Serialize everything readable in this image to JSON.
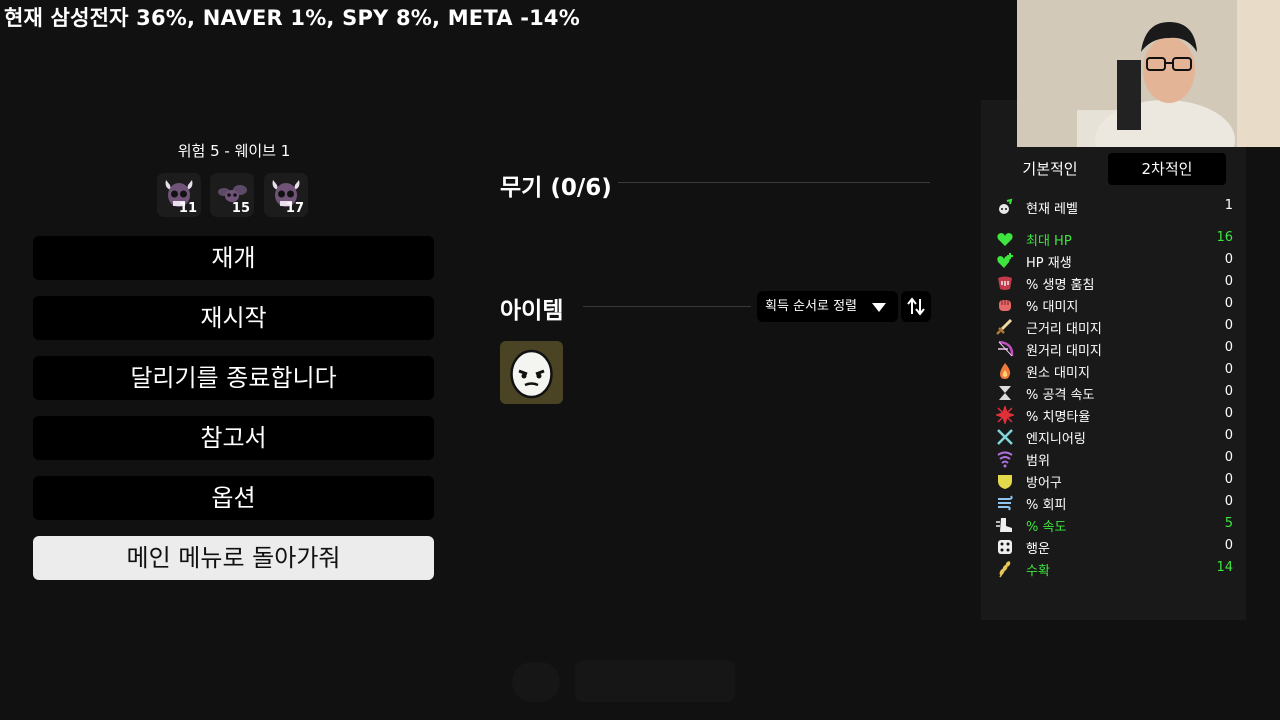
{
  "ticker": "현재 삼성전자 36%, NAVER 1%, SPY 8%, META -14%",
  "danger_wave": "위험 5 - 웨이브 1",
  "enemies": [
    {
      "icon": "horned-skull-icon",
      "count": "11"
    },
    {
      "icon": "fly-monster-icon",
      "count": "15"
    },
    {
      "icon": "horned-skull-icon",
      "count": "17"
    }
  ],
  "menu": {
    "resume": "재개",
    "restart": "재시작",
    "end_run": "달리기를 종료합니다",
    "encyclopedia": "참고서",
    "options": "옵션",
    "main_menu": "메인 메뉴로 돌아가줘"
  },
  "weapons": {
    "title": "무기 (0/6)"
  },
  "items": {
    "title": "아이템",
    "sort_label": "획득 순서로 정렬",
    "list": [
      {
        "icon": "potato-character-icon"
      }
    ]
  },
  "stats": {
    "tabs": [
      "기본적인",
      "2차적인"
    ],
    "active_tab": "2차적인",
    "level": {
      "icon": "level-icon",
      "label": "현재 레벨",
      "value": "1"
    },
    "rows": [
      {
        "icon": "heart-icon",
        "label": "최대 HP",
        "value": "16",
        "highlight": true
      },
      {
        "icon": "hp-regen-icon",
        "label": "HP 재생",
        "value": "0"
      },
      {
        "icon": "lifesteal-icon",
        "label": "% 생명 훔침",
        "value": "0"
      },
      {
        "icon": "damage-fist-icon",
        "label": "% 대미지",
        "value": "0"
      },
      {
        "icon": "sword-icon",
        "label": "근거리 대미지",
        "value": "0"
      },
      {
        "icon": "bow-icon",
        "label": "원거리 대미지",
        "value": "0"
      },
      {
        "icon": "flame-icon",
        "label": "원소 대미지",
        "value": "0"
      },
      {
        "icon": "hourglass-icon",
        "label": "% 공격 속도",
        "value": "0"
      },
      {
        "icon": "crit-star-icon",
        "label": "% 치명타율",
        "value": "0"
      },
      {
        "icon": "wrench-cross-icon",
        "label": "엔지니어링",
        "value": "0"
      },
      {
        "icon": "range-wave-icon",
        "label": "범위",
        "value": "0"
      },
      {
        "icon": "shield-icon",
        "label": "방어구",
        "value": "0"
      },
      {
        "icon": "dodge-wind-icon",
        "label": "% 회피",
        "value": "0"
      },
      {
        "icon": "boot-speed-icon",
        "label": "% 속도",
        "value": "5",
        "highlight": true
      },
      {
        "icon": "dice-icon",
        "label": "행운",
        "value": "0"
      },
      {
        "icon": "wheat-icon",
        "label": "수확",
        "value": "14",
        "highlight": true
      }
    ]
  },
  "colors": {
    "highlight": "#3ee53e",
    "item_slot": "#4a4425"
  }
}
